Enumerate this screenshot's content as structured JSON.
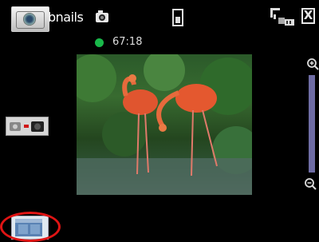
{
  "top_bar": {
    "title": "bnails",
    "icons": [
      "camera-mode-icon",
      "video-camera-icon",
      "battery-icon",
      "signal-icon",
      "close-icon"
    ],
    "close_label": "X"
  },
  "status": {
    "time_remaining": "67:18",
    "indicator_color": "#19b84a"
  },
  "preview": {
    "subject": "flamingos"
  },
  "zoom": {
    "track_color": "#6e6ca4"
  },
  "highlight_color": "#e01414"
}
